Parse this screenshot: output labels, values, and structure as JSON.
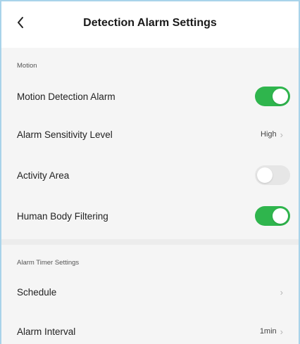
{
  "header": {
    "title": "Detection Alarm Settings"
  },
  "sections": [
    {
      "label": "Motion",
      "items": [
        {
          "label": "Motion Detection Alarm",
          "toggle": true
        },
        {
          "label": "Alarm Sensitivity Level",
          "value": "High"
        },
        {
          "label": "Activity Area",
          "toggle": false
        },
        {
          "label": "Human Body Filtering",
          "toggle": true
        }
      ]
    },
    {
      "label": "Alarm Timer Settings",
      "items": [
        {
          "label": "Schedule",
          "value": ""
        },
        {
          "label": "Alarm Interval",
          "value": "1min"
        }
      ]
    }
  ],
  "colors": {
    "toggle_on": "#2fb54d",
    "toggle_off": "#e6e6e6",
    "chevron": "#b5b5b5"
  },
  "icons": {
    "back": "chevron-left-icon",
    "chevron": "chevron-right-icon"
  }
}
